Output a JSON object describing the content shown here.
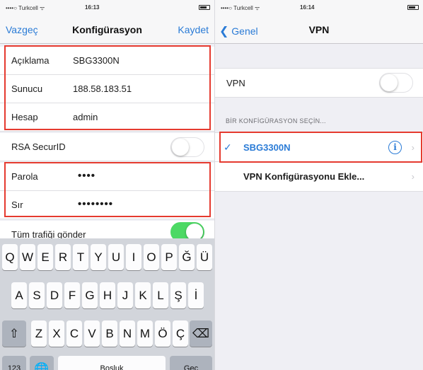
{
  "left": {
    "status": {
      "carrier": "••••○ Turkcell ᯤ",
      "time": "16:13"
    },
    "nav": {
      "cancel": "Vazgeç",
      "title": "Konfigürasyon",
      "save": "Kaydet"
    },
    "rows": {
      "aciklama": {
        "label": "Açıklama",
        "value": "SBG3300N"
      },
      "sunucu": {
        "label": "Sunucu",
        "value": "188.58.183.51"
      },
      "hesap": {
        "label": "Hesap",
        "value": "admin"
      },
      "rsa": {
        "label": "RSA SecurID",
        "on": false
      },
      "parola": {
        "label": "Parola",
        "value": "••••"
      },
      "sir": {
        "label": "Sır",
        "value": "••••••••"
      },
      "tum": {
        "label": "Tüm trafiği gönder",
        "on": true
      }
    },
    "keyboard": {
      "row1": [
        "Q",
        "W",
        "E",
        "R",
        "T",
        "Y",
        "U",
        "I",
        "O",
        "P",
        "Ğ",
        "Ü"
      ],
      "row2": [
        "A",
        "S",
        "D",
        "F",
        "G",
        "H",
        "J",
        "K",
        "L",
        "Ş",
        "İ"
      ],
      "row3": [
        "Z",
        "X",
        "C",
        "V",
        "B",
        "N",
        "M",
        "Ö",
        "Ç"
      ],
      "shift": "⇧",
      "backspace": "⌫",
      "numbers": "123",
      "globe": "🌐",
      "space": "Boşluk",
      "go": "Geç"
    }
  },
  "right": {
    "status": {
      "carrier": "••••○ Turkcell ᯤ",
      "time": "16:14"
    },
    "nav": {
      "back": "Genel",
      "title": "VPN"
    },
    "vpn_row": {
      "label": "VPN",
      "on": false
    },
    "section_header": "BİR KONFİGÜRASYON SEÇİN...",
    "config_item": {
      "check": "✓",
      "label": "SBG3300N",
      "info": "i"
    },
    "add_config": {
      "label": "VPN Konfigürasyonu Ekle..."
    }
  },
  "colors": {
    "accent": "#2a7bd6",
    "highlight": "#e53a2f",
    "toggle_on": "#4cd964"
  }
}
